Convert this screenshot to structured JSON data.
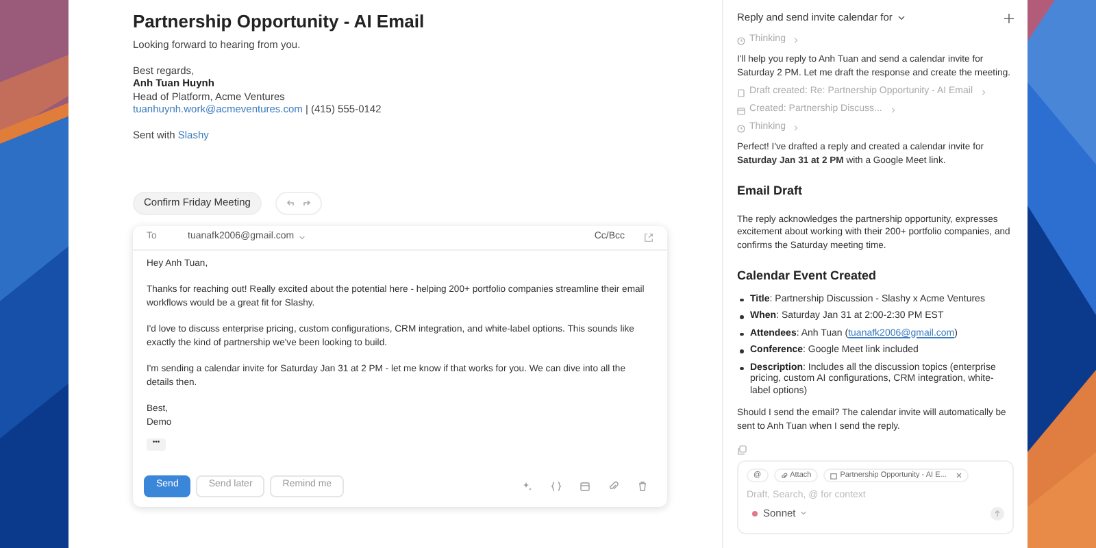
{
  "email": {
    "title": "Partnership Opportunity - AI Email",
    "blocks": [
      [
        {
          "kind": "plain",
          "text": "Looking forward to hearing from you."
        }
      ],
      [
        {
          "kind": "plain",
          "text": "Best regards,"
        },
        {
          "kind": "strong",
          "text": "Anh Tuan Huynh"
        },
        {
          "kind": "plain",
          "text": "Head of Platform, Acme Ventures"
        },
        {
          "kind": "link_first",
          "link": "tuanhuynh.work@acmeventures.com",
          "text": "| (415) 555-0142"
        }
      ],
      [
        {
          "kind": "link_last",
          "text": "Sent with",
          "link": "Slashy"
        }
      ]
    ]
  },
  "suggestion": "Confirm Friday Meeting",
  "compose": {
    "to_label": "To",
    "to": "tuanafk2006@gmail.com",
    "cc": "Cc/Bcc",
    "paragraphs": [
      [
        "Hey Anh Tuan,"
      ],
      [
        "Thanks for reaching out! Really excited about the potential here - helping 200+ portfolio companies streamline their email workflows would be a great fit for Slashy."
      ],
      [
        "I'd love to discuss enterprise pricing, custom configurations, CRM integration, and white-label options. This sounds like exactly the kind of partnership we've been looking to build."
      ],
      [
        "I'm sending a calendar invite for Saturday Jan 31 at 2 PM - let me know if that works for you. We can dive into all the details then."
      ],
      [
        "Best,",
        "Demo"
      ]
    ],
    "more": "•••",
    "buttons": [
      {
        "kind": "primary",
        "label": "Send"
      },
      {
        "kind": "secondary",
        "label": "Send later"
      },
      {
        "kind": "secondary",
        "label": "Remind me"
      }
    ]
  },
  "chat": {
    "title": "Reply and send invite calendar for",
    "items": [
      {
        "kind": "thinking",
        "text": "Thinking"
      },
      {
        "kind": "text",
        "text": "I'll help you reply to Anh Tuan and send a calendar invite for Saturday 2 PM. Let me draft the response and create the meeting."
      },
      {
        "kind": "draft",
        "text": "Draft created: Re: Partnership Opportunity - AI Email"
      },
      {
        "kind": "event",
        "text": "Created: Partnership Discuss..."
      },
      {
        "kind": "thinking",
        "text": "Thinking"
      },
      {
        "kind": "text",
        "text": "Perfect! I've drafted a reply and created a calendar invite for **Saturday Jan 31 at 2 PM** with a Google Meet link."
      },
      {
        "kind": "heading",
        "text": "**Email Draft**"
      },
      {
        "kind": "text",
        "text": "The reply acknowledges the partnership opportunity, expresses excitement about working with their 200+ portfolio companies, and confirms the Saturday meeting time."
      },
      {
        "kind": "heading",
        "text": "**Calendar Event Created**"
      },
      {
        "kind": "bullets",
        "bullets": [
          {
            "label": "Title",
            "text": ": Partnership Discussion - Slashy x Acme Ventures"
          },
          {
            "label": "When",
            "text": ": Saturday Jan 31 at 2:00-2:30 PM EST"
          },
          {
            "label": "Attendees",
            "text": ": Anh Tuan (",
            "link": "tuanafk2006@gmail.com",
            "after": ")"
          },
          {
            "label": "Conference",
            "text": ": Google Meet link included"
          },
          {
            "label": "Description",
            "text": ": Includes all the discussion topics (enterprise pricing, custom AI configurations, CRM integration, white-label options)"
          }
        ]
      },
      {
        "kind": "text",
        "text": "Should I send the email? The calendar invite will automatically be sent to Anh Tuan when I send the reply."
      }
    ],
    "input": {
      "chips": [
        {
          "kind": "mention",
          "text": "@"
        },
        {
          "kind": "attach",
          "text": "Attach"
        },
        {
          "kind": "context",
          "text": "Partnership Opportunity - AI E..."
        }
      ],
      "placeholder": "Draft, Search, @ for context",
      "model": "Sonnet"
    }
  }
}
